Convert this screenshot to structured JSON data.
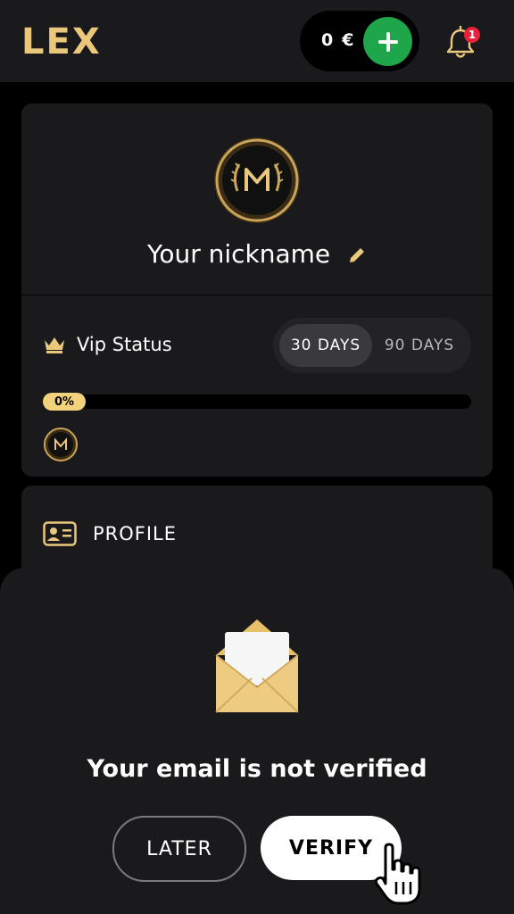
{
  "header": {
    "logo": "LEX",
    "balance_amount": "0",
    "balance_currency": "€",
    "notification_count": "1"
  },
  "profile_card": {
    "nickname": "Your nickname",
    "vip_label": "Vip Status",
    "toggle": [
      "30 DAYS",
      "90 DAYS"
    ],
    "selected_toggle": "30 DAYS",
    "progress_text": "0%",
    "progress_fraction": 0
  },
  "profile_section": {
    "label": "PROFILE"
  },
  "email_sheet": {
    "title": "Your email is not verified",
    "later_label": "LATER",
    "verify_label": "VERIFY"
  },
  "colors": {
    "gold": "#e9c77b",
    "add_green": "#1fa64a",
    "badge_red": "#e8213a",
    "progress_gold": "#f3d27c"
  }
}
